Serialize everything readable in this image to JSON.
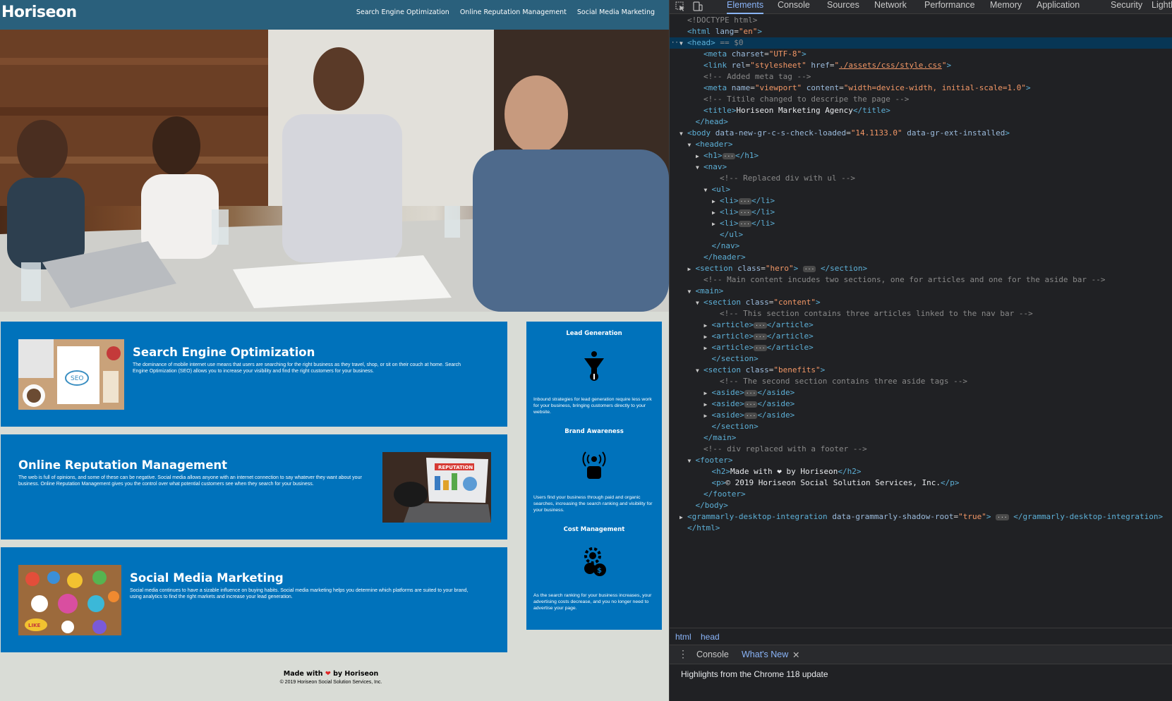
{
  "site": {
    "logo": "Horiseon",
    "nav": [
      "Search Engine Optimization",
      "Online Reputation Management",
      "Social Media Marketing"
    ],
    "content": [
      {
        "title": "Search Engine Optimization",
        "text": "The dominance of mobile internet use means that users are searching for the right business as they travel, shop, or sit on their couch at home. Search Engine Optimization (SEO) allows you to increase your visibility and find the right customers for your business.",
        "image_label": "SEO"
      },
      {
        "title": "Online Reputation Management",
        "text": "The web is full of opinions, and some of these can be negative. Social media allows anyone with an internet connection to say whatever they want about your business. Online Reputation Management gives you the control over what potential customers see when they search for your business.",
        "image_label": "REPUTATION"
      },
      {
        "title": "Social Media Marketing",
        "text": "Social media continues to have a sizable influence on buying habits. Social media marketing helps you determine which platforms are suited to your brand, using analytics to find the right markets and increase your lead generation.",
        "image_label": "LIKE"
      }
    ],
    "benefits": [
      {
        "title": "Lead Generation",
        "text": "Inbound strategies for lead generation require less work for your business, bringing customers directly to your website.",
        "icon": "funnel-icon"
      },
      {
        "title": "Brand Awareness",
        "text": "Users find your business through paid and organic searches, increasing the search ranking and visibility for your business.",
        "icon": "broadcast-person-icon"
      },
      {
        "title": "Cost Management",
        "text": "As the search ranking for your business increases, your advertising costs decrease, and you no longer need to advertise your page.",
        "icon": "gear-dollar-icon"
      }
    ],
    "footer": {
      "made_with_prefix": "Made with",
      "made_with_suffix": "by Horiseon",
      "copyright": "© 2019 Horiseon Social Solution Services, Inc."
    }
  },
  "devtools": {
    "tabs": [
      "Elements",
      "Console",
      "Sources",
      "Network",
      "Performance",
      "Memory",
      "Application",
      "Security",
      "Lighth"
    ],
    "active_tab": "Elements",
    "lines": [
      {
        "indent": 0,
        "tri": "",
        "html": "<span class=\"cmt\">&lt;!DOCTYPE html&gt;</span>"
      },
      {
        "indent": 0,
        "tri": "",
        "html": "<span class=\"tag\">&lt;html</span> <span class=\"attr\">lang</span>=<span class=\"val\">\"en\"</span><span class=\"tag\">&gt;</span>"
      },
      {
        "indent": 0,
        "tri": "▼",
        "sel": true,
        "html": "<span class=\"tag\">&lt;head&gt;</span> <span class=\"cmt\">== $0</span>"
      },
      {
        "indent": 2,
        "tri": "",
        "html": "<span class=\"tag\">&lt;meta</span> <span class=\"attr\">charset</span>=<span class=\"val\">\"UTF-8\"</span><span class=\"tag\">&gt;</span>"
      },
      {
        "indent": 2,
        "tri": "",
        "html": "<span class=\"tag\">&lt;link</span> <span class=\"attr\">rel</span>=<span class=\"val\">\"stylesheet\"</span> <span class=\"attr\">href</span>=<span class=\"val\">\"</span><span class=\"link\">./assets/css/style.css</span><span class=\"val\">\"</span><span class=\"tag\">&gt;</span>"
      },
      {
        "indent": 2,
        "tri": "",
        "html": "<span class=\"cmt\">&lt;!-- Added meta tag --&gt;</span>"
      },
      {
        "indent": 2,
        "tri": "",
        "html": "<span class=\"tag\">&lt;meta</span> <span class=\"attr\">name</span>=<span class=\"val\">\"viewport\"</span> <span class=\"attr\">content</span>=<span class=\"val\">\"width=device-width, initial-scale=1.0\"</span><span class=\"tag\">&gt;</span>"
      },
      {
        "indent": 2,
        "tri": "",
        "html": "<span class=\"cmt\">&lt;!-- Titile changed to descripe the page --&gt;</span>"
      },
      {
        "indent": 2,
        "tri": "",
        "html": "<span class=\"tag\">&lt;title&gt;</span><span class=\"txt\">Horiseon Marketing Agency</span><span class=\"tag\">&lt;/title&gt;</span>"
      },
      {
        "indent": 1,
        "tri": "",
        "html": "<span class=\"tag\">&lt;/head&gt;</span>"
      },
      {
        "indent": 0,
        "tri": "▼",
        "html": "<span class=\"tag\">&lt;body</span> <span class=\"attr\">data-new-gr-c-s-check-loaded</span>=<span class=\"val\">\"14.1133.0\"</span> <span class=\"attr\">data-gr-ext-installed</span><span class=\"tag\">&gt;</span>"
      },
      {
        "indent": 1,
        "tri": "▼",
        "html": "<span class=\"tag\">&lt;header&gt;</span>"
      },
      {
        "indent": 2,
        "tri": "▶",
        "html": "<span class=\"tag\">&lt;h1&gt;</span><span class=\"ell\">···</span><span class=\"tag\">&lt;/h1&gt;</span>"
      },
      {
        "indent": 2,
        "tri": "▼",
        "html": "<span class=\"tag\">&lt;nav&gt;</span>"
      },
      {
        "indent": 4,
        "tri": "",
        "html": "<span class=\"cmt\">&lt;!-- Replaced div with ul --&gt;</span>"
      },
      {
        "indent": 3,
        "tri": "▼",
        "html": "<span class=\"tag\">&lt;ul&gt;</span>"
      },
      {
        "indent": 4,
        "tri": "▶",
        "html": "<span class=\"tag\">&lt;li&gt;</span><span class=\"ell\">···</span><span class=\"tag\">&lt;/li&gt;</span>"
      },
      {
        "indent": 4,
        "tri": "▶",
        "html": "<span class=\"tag\">&lt;li&gt;</span><span class=\"ell\">···</span><span class=\"tag\">&lt;/li&gt;</span>"
      },
      {
        "indent": 4,
        "tri": "▶",
        "html": "<span class=\"tag\">&lt;li&gt;</span><span class=\"ell\">···</span><span class=\"tag\">&lt;/li&gt;</span>"
      },
      {
        "indent": 4,
        "tri": "",
        "html": "<span class=\"tag\">&lt;/ul&gt;</span>"
      },
      {
        "indent": 3,
        "tri": "",
        "html": "<span class=\"tag\">&lt;/nav&gt;</span>"
      },
      {
        "indent": 2,
        "tri": "",
        "html": "<span class=\"tag\">&lt;/header&gt;</span>"
      },
      {
        "indent": 1,
        "tri": "▶",
        "html": "<span class=\"tag\">&lt;section</span> <span class=\"attr\">class</span>=<span class=\"val\">\"hero\"</span><span class=\"tag\">&gt;</span> <span class=\"ell\">···</span> <span class=\"tag\">&lt;/section&gt;</span>"
      },
      {
        "indent": 2,
        "tri": "",
        "html": "<span class=\"cmt\">&lt;!-- Main content incudes two sections, one for articles and one for the aside bar --&gt;</span>"
      },
      {
        "indent": 1,
        "tri": "▼",
        "html": "<span class=\"tag\">&lt;main&gt;</span>"
      },
      {
        "indent": 2,
        "tri": "▼",
        "html": "<span class=\"tag\">&lt;section</span> <span class=\"attr\">class</span>=<span class=\"val\">\"content\"</span><span class=\"tag\">&gt;</span>"
      },
      {
        "indent": 4,
        "tri": "",
        "html": "<span class=\"cmt\">&lt;!-- This section contains three articles linked to the nav bar --&gt;</span>"
      },
      {
        "indent": 3,
        "tri": "▶",
        "html": "<span class=\"tag\">&lt;article&gt;</span><span class=\"ell\">···</span><span class=\"tag\">&lt;/article&gt;</span>"
      },
      {
        "indent": 3,
        "tri": "▶",
        "html": "<span class=\"tag\">&lt;article&gt;</span><span class=\"ell\">···</span><span class=\"tag\">&lt;/article&gt;</span>"
      },
      {
        "indent": 3,
        "tri": "▶",
        "html": "<span class=\"tag\">&lt;article&gt;</span><span class=\"ell\">···</span><span class=\"tag\">&lt;/article&gt;</span>"
      },
      {
        "indent": 3,
        "tri": "",
        "html": "<span class=\"tag\">&lt;/section&gt;</span>"
      },
      {
        "indent": 2,
        "tri": "▼",
        "html": "<span class=\"tag\">&lt;section</span> <span class=\"attr\">class</span>=<span class=\"val\">\"benefits\"</span><span class=\"tag\">&gt;</span>"
      },
      {
        "indent": 4,
        "tri": "",
        "html": "<span class=\"cmt\">&lt;!-- The second section contains three aside tags --&gt;</span>"
      },
      {
        "indent": 3,
        "tri": "▶",
        "html": "<span class=\"tag\">&lt;aside&gt;</span><span class=\"ell\">···</span><span class=\"tag\">&lt;/aside&gt;</span>"
      },
      {
        "indent": 3,
        "tri": "▶",
        "html": "<span class=\"tag\">&lt;aside&gt;</span><span class=\"ell\">···</span><span class=\"tag\">&lt;/aside&gt;</span>"
      },
      {
        "indent": 3,
        "tri": "▶",
        "html": "<span class=\"tag\">&lt;aside&gt;</span><span class=\"ell\">···</span><span class=\"tag\">&lt;/aside&gt;</span>"
      },
      {
        "indent": 3,
        "tri": "",
        "html": "<span class=\"tag\">&lt;/section&gt;</span>"
      },
      {
        "indent": 2,
        "tri": "",
        "html": "<span class=\"tag\">&lt;/main&gt;</span>"
      },
      {
        "indent": 2,
        "tri": "",
        "html": "<span class=\"cmt\">&lt;!-- div replaced with a footer --&gt;</span>"
      },
      {
        "indent": 1,
        "tri": "▼",
        "html": "<span class=\"tag\">&lt;footer&gt;</span>"
      },
      {
        "indent": 3,
        "tri": "",
        "html": "<span class=\"tag\">&lt;h2&gt;</span><span class=\"txt\">Made with ❤ by Horiseon</span><span class=\"tag\">&lt;/h2&gt;</span>"
      },
      {
        "indent": 3,
        "tri": "",
        "html": "<span class=\"tag\">&lt;p&gt;</span><span class=\"txt\">© 2019 Horiseon Social Solution Services, Inc.</span><span class=\"tag\">&lt;/p&gt;</span>"
      },
      {
        "indent": 2,
        "tri": "",
        "html": "<span class=\"tag\">&lt;/footer&gt;</span>"
      },
      {
        "indent": 1,
        "tri": "",
        "html": "<span class=\"tag\">&lt;/body&gt;</span>"
      },
      {
        "indent": 0,
        "tri": "▶",
        "html": "<span class=\"tag\">&lt;grammarly-desktop-integration</span> <span class=\"attr\">data-grammarly-shadow-root</span>=<span class=\"val\">\"true\"</span><span class=\"tag\">&gt;</span> <span class=\"ell\">···</span> <span class=\"tag\">&lt;/grammarly-desktop-integration&gt;</span>"
      },
      {
        "indent": 0,
        "tri": "",
        "html": "<span class=\"tag\">&lt;/html&gt;</span>"
      }
    ],
    "breadcrumbs": [
      "html",
      "head"
    ],
    "drawer_tabs": [
      "Console",
      "What's New"
    ],
    "drawer_active": "What's New",
    "drawer_text": "Highlights from the Chrome 118 update"
  },
  "colors": {
    "header": "#2a607c",
    "card": "#0072bb",
    "page_bg": "#d9dcd6",
    "devtools_bg": "#202124",
    "devtools_accent": "#8ab4f8"
  }
}
